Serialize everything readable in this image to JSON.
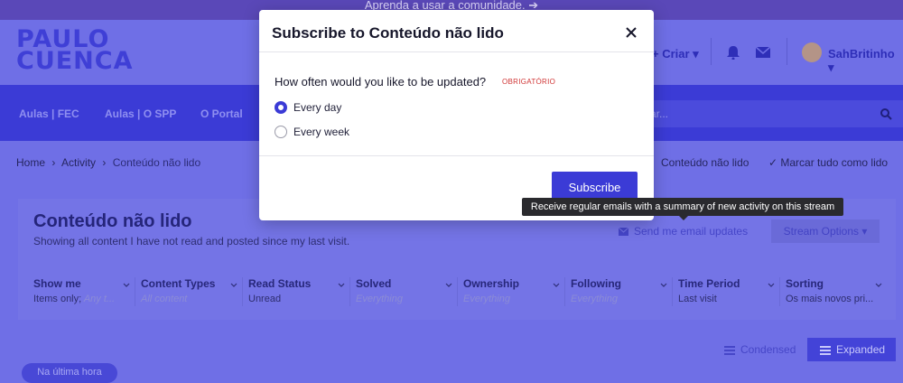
{
  "banner": {
    "text": "Aprenda a usar a comunidade. ➔"
  },
  "header": {
    "logo_line1": "PAULO",
    "logo_line2": "CUENCA",
    "create_label": "+ Criar ▾",
    "user_name": "SahBritinho ▾"
  },
  "nav": {
    "items": [
      "Aulas | FEC",
      "Aulas | O SPP",
      "O Portal"
    ],
    "search_placeholder": "scar..."
  },
  "breadcrumb": {
    "home": "Home",
    "activity": "Activity",
    "current": "Conteúdo não lido",
    "sep": "›",
    "right_current": "Conteúdo não lido",
    "mark_all": "✓  Marcar tudo como lido"
  },
  "panel": {
    "title": "Conteúdo não lido",
    "subtitle": "Showing all content I have not read and posted since my last visit.",
    "email_updates": "Send me email updates",
    "stream_options": "Stream Options ▾",
    "filters": [
      {
        "label": "Show me",
        "value": "Items only;",
        "placeholder": " Any t..."
      },
      {
        "label": "Content Types",
        "value": "",
        "placeholder": "All content"
      },
      {
        "label": "Read Status",
        "value": "Unread",
        "placeholder": ""
      },
      {
        "label": "Solved",
        "value": "",
        "placeholder": "Everything"
      },
      {
        "label": "Ownership",
        "value": "",
        "placeholder": "Everything"
      },
      {
        "label": "Following",
        "value": "",
        "placeholder": "Everything"
      },
      {
        "label": "Time Period",
        "value": "Last visit",
        "placeholder": ""
      },
      {
        "label": "Sorting",
        "value": "Os mais novos pri...",
        "placeholder": ""
      }
    ]
  },
  "view": {
    "condensed": "Condensed",
    "expanded": "Expanded",
    "pill": "Na última hora"
  },
  "dialog": {
    "title": "Subscribe to Conteúdo não lido",
    "question": "How often would you like to be updated?",
    "required": "OBRIGATÓRIO",
    "options": [
      {
        "label": "Every day",
        "selected": true
      },
      {
        "label": "Every week",
        "selected": false
      }
    ],
    "submit": "Subscribe"
  },
  "tooltip": {
    "text": "Receive regular emails with a summary of new activity on this stream"
  },
  "colors": {
    "accent": "#3b3bd6",
    "overlay": "#6f6fe6",
    "required": "#d03535"
  }
}
